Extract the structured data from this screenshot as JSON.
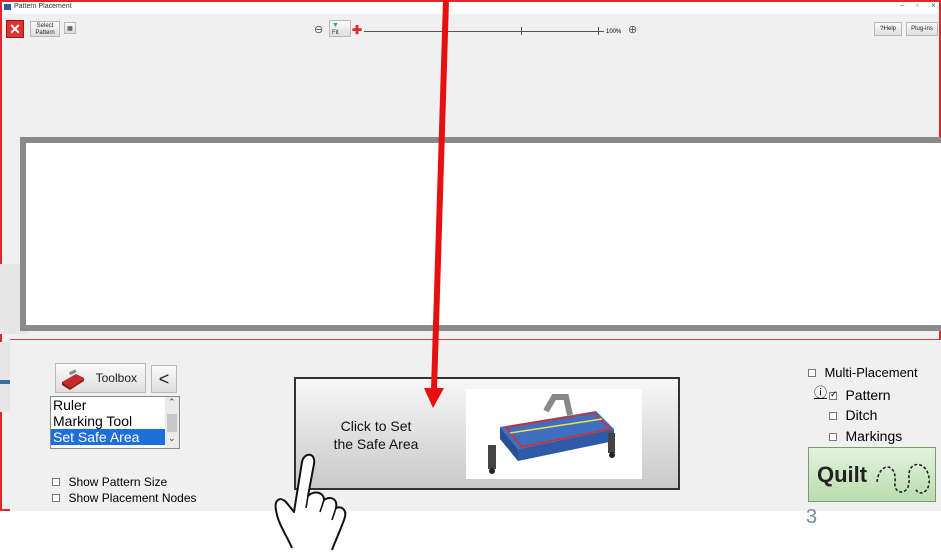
{
  "window": {
    "title": "Pattern Placement"
  },
  "toolbar": {
    "select_pattern": "Select Pattern",
    "fit_label": "Fit",
    "zoom_max": "100%",
    "help_label": "Help",
    "plugins_label": "Plug-ins"
  },
  "toolbox": {
    "label": "Toolbox",
    "back_label": "<"
  },
  "tool_list": {
    "items": [
      "Ruler",
      "Marking Tool",
      "Set Safe Area"
    ],
    "selected": "Set Safe Area"
  },
  "action_button": {
    "line1": "Click to Set",
    "line2": "the Safe Area"
  },
  "options": {
    "show_pattern_size": "Show Pattern Size",
    "show_placement_nodes": "Show Placement Nodes"
  },
  "placement": {
    "multi_placement": "Multi-Placement",
    "pattern": "Pattern",
    "ditch": "Ditch",
    "markings": "Markings",
    "info": "ⓘ"
  },
  "quilt_button": {
    "label": "Quilt"
  },
  "page_number": "3",
  "colors": {
    "accent_red": "#e02828",
    "selection_blue": "#1e6fd9",
    "quilt_green": "#cfe8c8"
  }
}
